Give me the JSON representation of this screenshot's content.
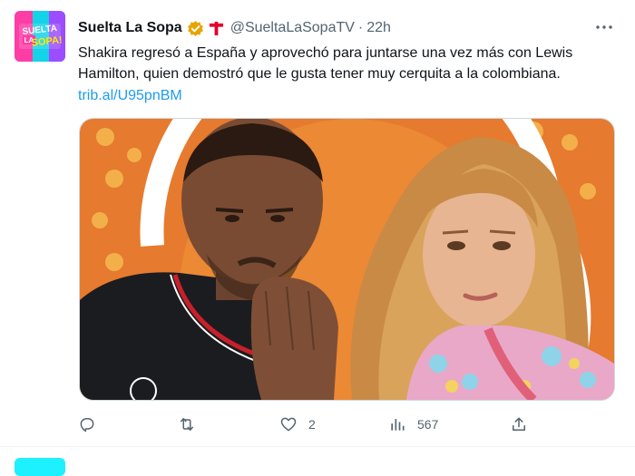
{
  "tweet": {
    "author_name": "Suelta La Sopa",
    "handle": "@SueltaLaSopaTV",
    "separator": "·",
    "time": "22h",
    "text": "Shakira regresó a España y aprovechó para juntarse una vez más con Lewis Hamilton, quien demostró que le gusta tener muy cerquita a la colombiana.",
    "link": "trib.al/U95pnBM",
    "avatar_lines": [
      "SUELTA",
      "LA",
      "SOPA!"
    ],
    "verified_color": "#e8a400",
    "network_logo_color": "#e4002b",
    "media_icon": "photo-collage-image",
    "actions": {
      "reply_count": "",
      "retweet_count": "",
      "like_count": "2",
      "views_count": "567"
    }
  },
  "colors": {
    "link": "#1d9bf0",
    "secondary_text": "#536471",
    "media_background": "#e67a2e"
  }
}
